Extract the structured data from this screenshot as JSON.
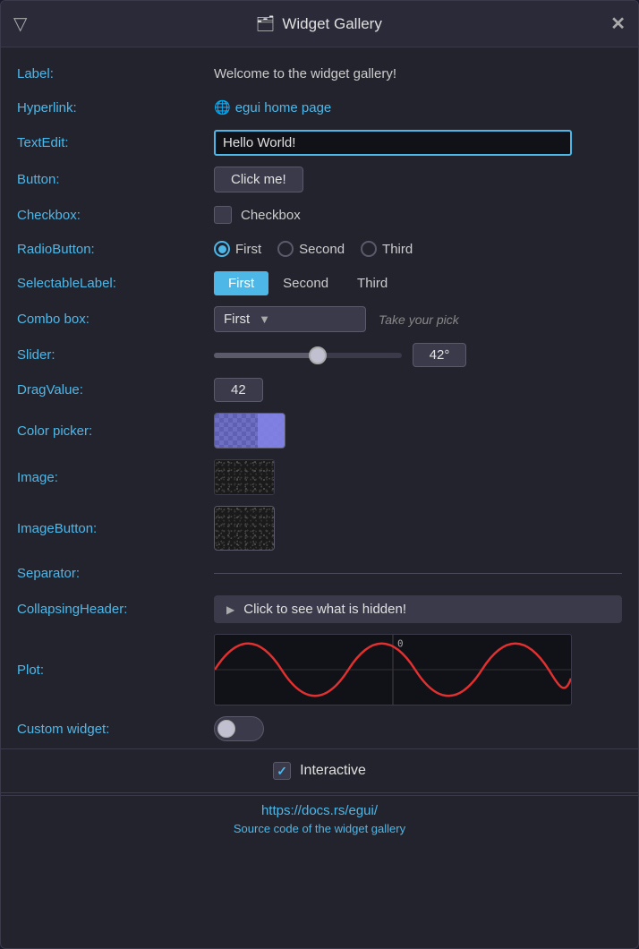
{
  "window": {
    "title": "Widget Gallery",
    "icon": "🗂",
    "menu_label": "▽",
    "close_label": "✕"
  },
  "rows": {
    "label": {
      "key": "Label:",
      "value": "Welcome to the widget gallery!"
    },
    "hyperlink": {
      "key": "Hyperlink:",
      "text": "egui home page",
      "globe": "🌐"
    },
    "textedit": {
      "key": "TextEdit:",
      "value": "Hello World!"
    },
    "button": {
      "key": "Button:",
      "label": "Click me!"
    },
    "checkbox": {
      "key": "Checkbox:",
      "label": "Checkbox",
      "checked": false
    },
    "radiobutton": {
      "key": "RadioButton:",
      "options": [
        "First",
        "Second",
        "Third"
      ],
      "selected": 0
    },
    "selectable_label": {
      "key": "SelectableLabel:",
      "options": [
        "First",
        "Second",
        "Third"
      ],
      "selected": 0
    },
    "combo_box": {
      "key": "Combo box:",
      "selected": "First",
      "hint": "Take your pick"
    },
    "slider": {
      "key": "Slider:",
      "value": 42,
      "unit": "°",
      "display": "42°",
      "percent": 55
    },
    "drag_value": {
      "key": "DragValue:",
      "value": "42"
    },
    "color_picker": {
      "key": "Color picker:"
    },
    "image": {
      "key": "Image:"
    },
    "image_button": {
      "key": "ImageButton:"
    },
    "separator": {
      "key": "Separator:"
    },
    "collapsing_header": {
      "key": "CollapsingHeader:",
      "label": "Click to see what is hidden!"
    },
    "plot": {
      "key": "Plot:",
      "zero_label": "0"
    },
    "custom_widget": {
      "key": "Custom widget:"
    }
  },
  "interactive": {
    "label": "Interactive",
    "checked": true,
    "check_symbol": "✓"
  },
  "footer": {
    "link_text": "https://docs.rs/egui/",
    "sub_text": "Source code of the widget gallery"
  }
}
